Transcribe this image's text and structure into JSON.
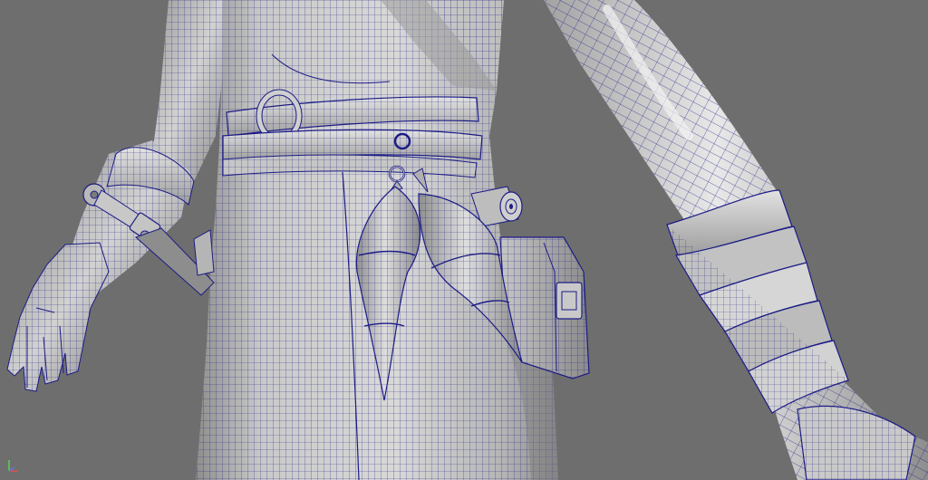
{
  "app": {
    "view": "perspective-viewport",
    "display_mode": "smooth-shade-wireframe-on-shaded"
  },
  "colors": {
    "background": "#6e6e6e",
    "surface_light": "#d9d9d9",
    "surface_mid": "#a8a8a8",
    "surface_dark": "#7e7e7e",
    "wire": "#1c1c86",
    "hair": "#151515"
  },
  "gizmo": {
    "x_label": "",
    "y_label": "",
    "z_label": ""
  },
  "hud": {
    "bottom_label": ""
  },
  "icons": {
    "axis": "axis-gizmo-icon"
  }
}
